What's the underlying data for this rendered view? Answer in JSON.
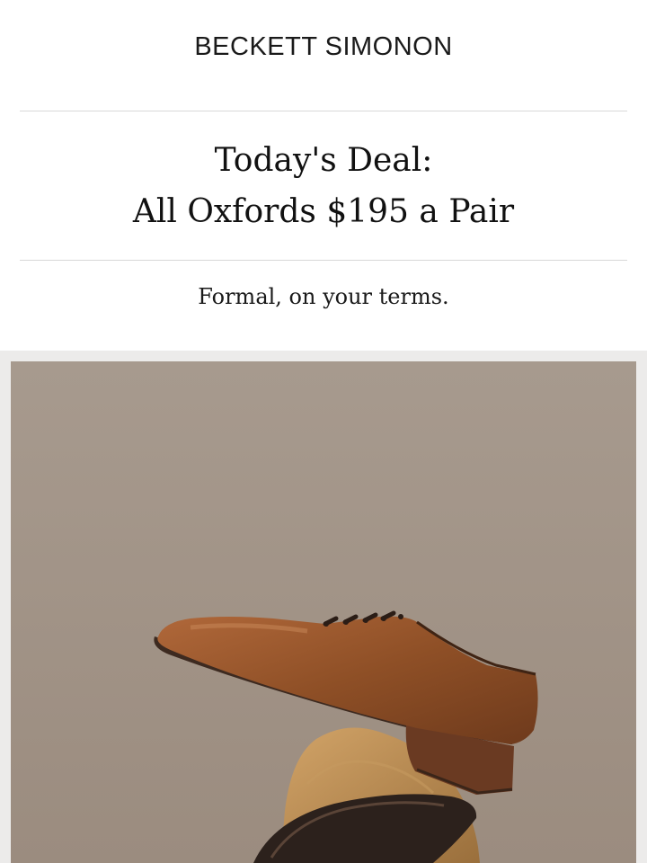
{
  "brand": {
    "name": "BECKETT SIMONON"
  },
  "promo": {
    "headline_line1": "Today's Deal:",
    "headline_line2": "All Oxfords $195 a Pair",
    "tagline": "Formal, on your terms."
  },
  "hero": {
    "image_label": "oxford-shoe-on-rock",
    "colors": {
      "background": "#a39488",
      "leather": "#8e4f26",
      "rock": "#b98a4d",
      "sole": "#2c211c"
    }
  }
}
